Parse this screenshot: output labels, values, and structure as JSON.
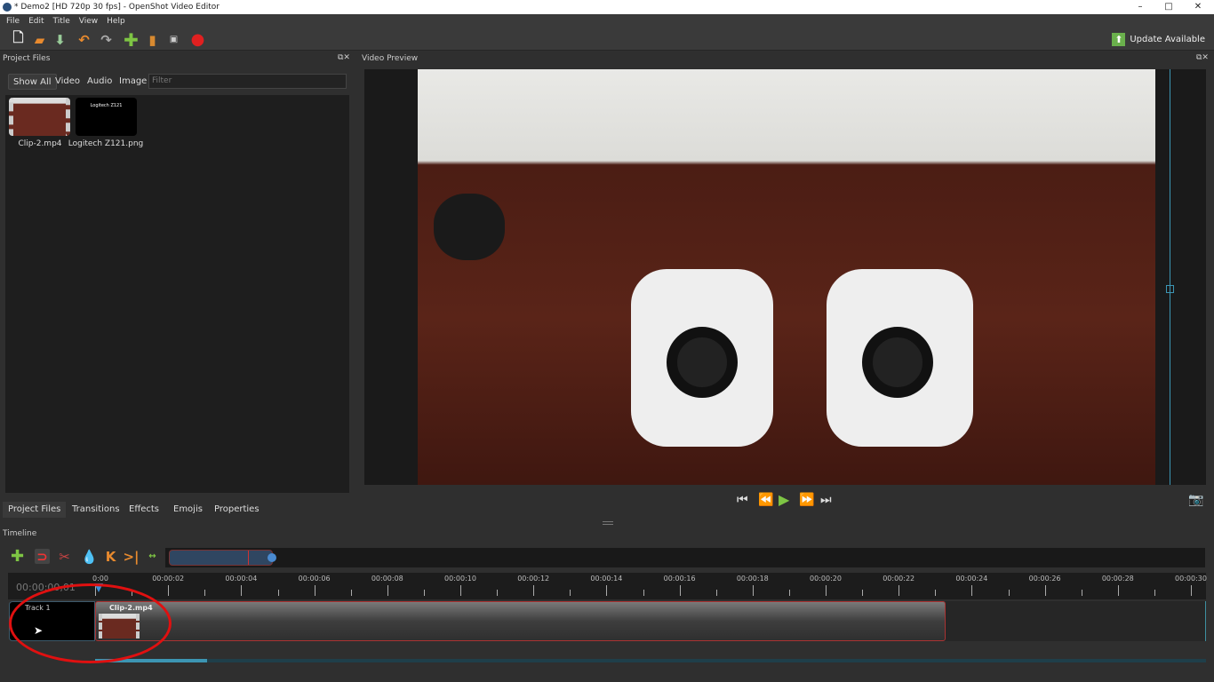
{
  "window": {
    "title": "* Demo2 [HD 720p 30 fps] - OpenShot Video Editor",
    "controls": [
      "minimize",
      "maximize",
      "close"
    ]
  },
  "menu": [
    "File",
    "Edit",
    "Title",
    "View",
    "Help"
  ],
  "toolbar": {
    "icons": [
      "new-project-icon",
      "open-project-icon",
      "save-project-icon",
      "undo-icon",
      "redo-icon",
      "import-files-icon",
      "profile-icon",
      "fullscreen-icon",
      "export-video-icon"
    ],
    "update_label": "Update Available"
  },
  "project_files": {
    "title": "Project Files",
    "filters": [
      "Show All",
      "Video",
      "Audio",
      "Image"
    ],
    "filter_placeholder": "Filter",
    "files": [
      {
        "name": "Clip-2.mp4",
        "type": "video"
      },
      {
        "name": "Logitech Z121.png",
        "type": "image",
        "thumb_text": "Logitech Z121"
      }
    ]
  },
  "bottom_tabs": [
    "Project Files",
    "Transitions",
    "Effects",
    "Emojis",
    "Properties"
  ],
  "preview": {
    "title": "Video Preview",
    "controls": [
      "jump-start-icon",
      "rewind-icon",
      "play-icon",
      "fast-forward-icon",
      "jump-end-icon"
    ]
  },
  "timeline": {
    "title": "Timeline",
    "timecode": "00:00:00,01",
    "ruler_labels": [
      "0:00",
      "00:00:02",
      "00:00:04",
      "00:00:06",
      "00:00:08",
      "00:00:10",
      "00:00:12",
      "00:00:14",
      "00:00:16",
      "00:00:18",
      "00:00:20",
      "00:00:22",
      "00:00:24",
      "00:00:26",
      "00:00:28",
      "00:00:30"
    ],
    "track": {
      "name": "Track 1"
    },
    "clip": {
      "name": "Clip-2.mp4"
    }
  },
  "colors": {
    "accent": "#3c95b3",
    "annotation": "#e01010",
    "clip_border": "#aa3333"
  }
}
